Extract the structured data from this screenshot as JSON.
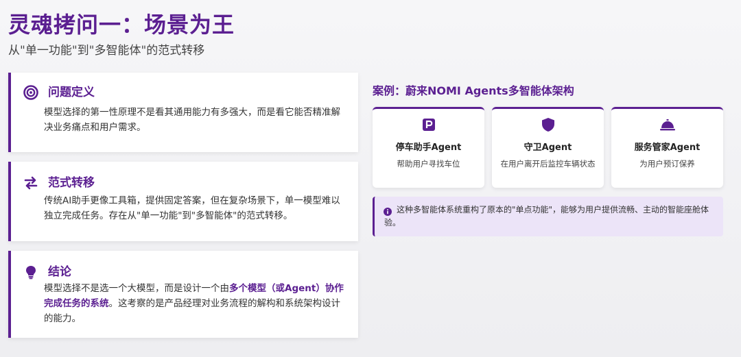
{
  "header": {
    "title": "灵魂拷问一：场景为王",
    "subtitle": "从\"单一功能\"到\"多智能体\"的范式转移"
  },
  "cards": [
    {
      "icon": "target-icon",
      "heading": "问题定义",
      "body": "模型选择的第一性原理不是看其通用能力有多强大，而是看它能否精准解决业务痛点和用户需求。"
    },
    {
      "icon": "swap-arrows-icon",
      "heading": "范式转移",
      "body": "传统AI助手更像工具箱，提供固定答案，但在复杂场景下，单一模型难以独立完成任务。存在从\"单一功能\"到\"多智能体\"的范式转移。"
    },
    {
      "icon": "lightbulb-icon",
      "heading": "结论",
      "body_pre": "模型选择不是选一个大模型，而是设计一个由",
      "body_bold": "多个模型（或Agent）协作完成任务的系统",
      "body_post": "。这考察的是产品经理对业务流程的解构和系统架构设计的能力。"
    }
  ],
  "case": {
    "title": "案例：蔚来NOMI Agents多智能体架构",
    "agents": [
      {
        "icon": "parking-icon",
        "name": "停车助手Agent",
        "desc": "帮助用户寻找车位"
      },
      {
        "icon": "shield-icon",
        "name": "守卫Agent",
        "desc": "在用户离开后监控车辆状态"
      },
      {
        "icon": "concierge-bell-icon",
        "name": "服务管家Agent",
        "desc": "为用户预订保养"
      }
    ],
    "note": {
      "icon": "info-icon",
      "text": "这种多智能体系统重构了原本的\"单点功能\"，能够为用户提供流畅、主动的智能座舱体验。"
    }
  },
  "colors": {
    "accent": "#5b1f91",
    "note_bg": "#ece4f8"
  }
}
